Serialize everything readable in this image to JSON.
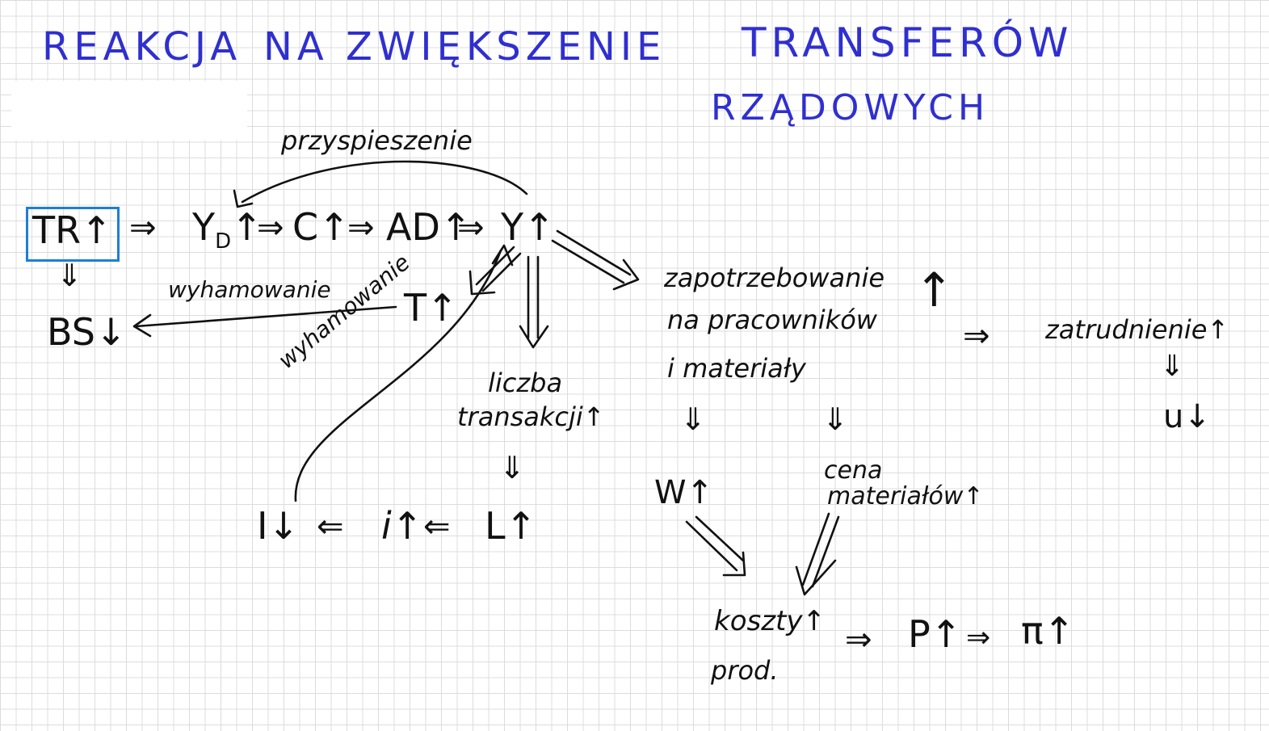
{
  "title": {
    "line1_part1": "REAKCJA",
    "line1_part2": "NA ZWIĘKSZENIE",
    "line1_part3": "TRANSFERÓW",
    "line2": "RZĄDOWYCH"
  },
  "nodes": {
    "tr": "TR↑",
    "yd": "Y",
    "yd_sub": "D",
    "yd_arrow": "↑",
    "c": "C↑",
    "ad": "AD↑",
    "y": "Y↑",
    "bs": "BS↓",
    "t": "T↑",
    "liczba_transakcji_1": "liczba",
    "liczba_transakcji_2": "transakcji↑",
    "i_invest": "I↓",
    "i_rate": "i↑",
    "l": "L↑",
    "zapotrzebowanie_1": "zapotrzebowanie",
    "zapotrzebowanie_2": "na pracowników",
    "zapotrzebowanie_3": "i materiały",
    "zapotrzebowanie_arrow": "↑",
    "zatrudnienie": "zatrudnienie↑",
    "u": "u↓",
    "w": "W↑",
    "cena_1": "cena",
    "cena_2": "materiałów↑",
    "koszty_1": "koszty↑",
    "koszty_2": "prod.",
    "p": "P↑",
    "pi": "π↑"
  },
  "labels": {
    "przyspieszenie": "przyspieszenie",
    "wyhamowanie_top": "wyhamowanie",
    "wyhamowanie_curve": "wyhamowanie"
  },
  "connectors": {
    "implies": "⇒",
    "implied_by": "⇐",
    "down": "⇓"
  },
  "colors": {
    "title": "#2f2fd0",
    "box": "#1c7fd6",
    "ink": "#111111"
  }
}
